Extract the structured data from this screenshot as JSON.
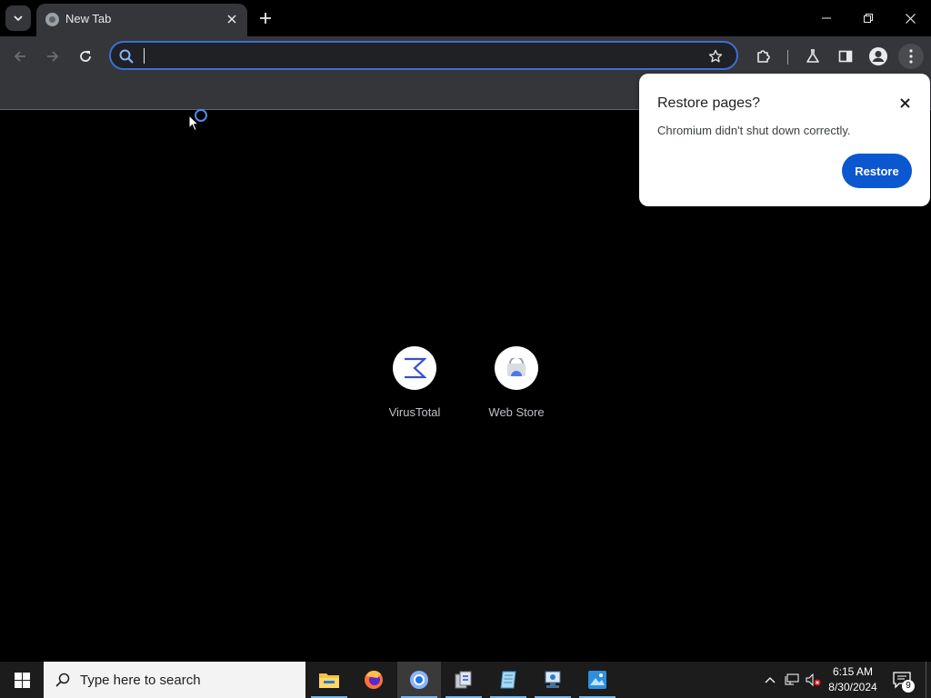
{
  "browser": {
    "tab": {
      "title": "New Tab"
    },
    "omnibox": {
      "value": "",
      "placeholder": ""
    },
    "colors": {
      "accent": "#0b57d0",
      "omnibox_border": "#3b6fd6",
      "toolbar": "#35363a"
    }
  },
  "shortcuts": [
    {
      "label": "VirusTotal",
      "icon": "virustotal-icon"
    },
    {
      "label": "Web Store",
      "icon": "web-store-icon"
    }
  ],
  "restore_bubble": {
    "title": "Restore pages?",
    "message": "Chromium didn't shut down correctly.",
    "button": "Restore"
  },
  "taskbar": {
    "search_placeholder": "Type here to search",
    "apps": [
      {
        "name": "file-explorer-icon"
      },
      {
        "name": "firefox-icon"
      },
      {
        "name": "chromium-icon",
        "active": true
      },
      {
        "name": "app-icon-4"
      },
      {
        "name": "app-icon-5"
      },
      {
        "name": "app-icon-6"
      },
      {
        "name": "app-icon-7"
      }
    ],
    "clock": {
      "time": "6:15 AM",
      "date": "8/30/2024"
    },
    "notification_count": "9"
  }
}
